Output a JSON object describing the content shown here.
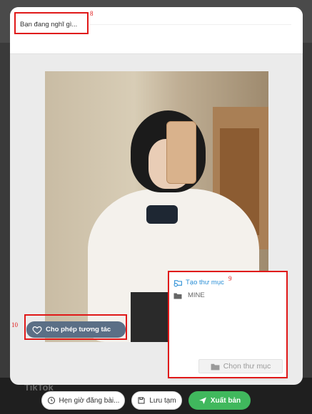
{
  "composer": {
    "placeholder": "Bạn đang nghĩ gì..."
  },
  "post_controls": {
    "allow_interaction_label": "Cho phép tương tác"
  },
  "folder_panel": {
    "create_folder_label": "Tạo thư mục",
    "folders": [
      "MINE"
    ],
    "choose_folder_label": "Chọn thư mục"
  },
  "footer": {
    "schedule_label": "Hẹn giờ đăng bài...",
    "draft_label": "Lưu tạm",
    "publish_label": "Xuất bản"
  },
  "background": {
    "app_name": "TikTok"
  },
  "annotations": {
    "composer_marker": "8",
    "folder_marker": "9",
    "interaction_marker": "10"
  },
  "colors": {
    "accent_green": "#40b85d",
    "link_blue": "#2b8fd6",
    "annotation_red": "#e01818",
    "interaction_button": "#5b6f86"
  }
}
